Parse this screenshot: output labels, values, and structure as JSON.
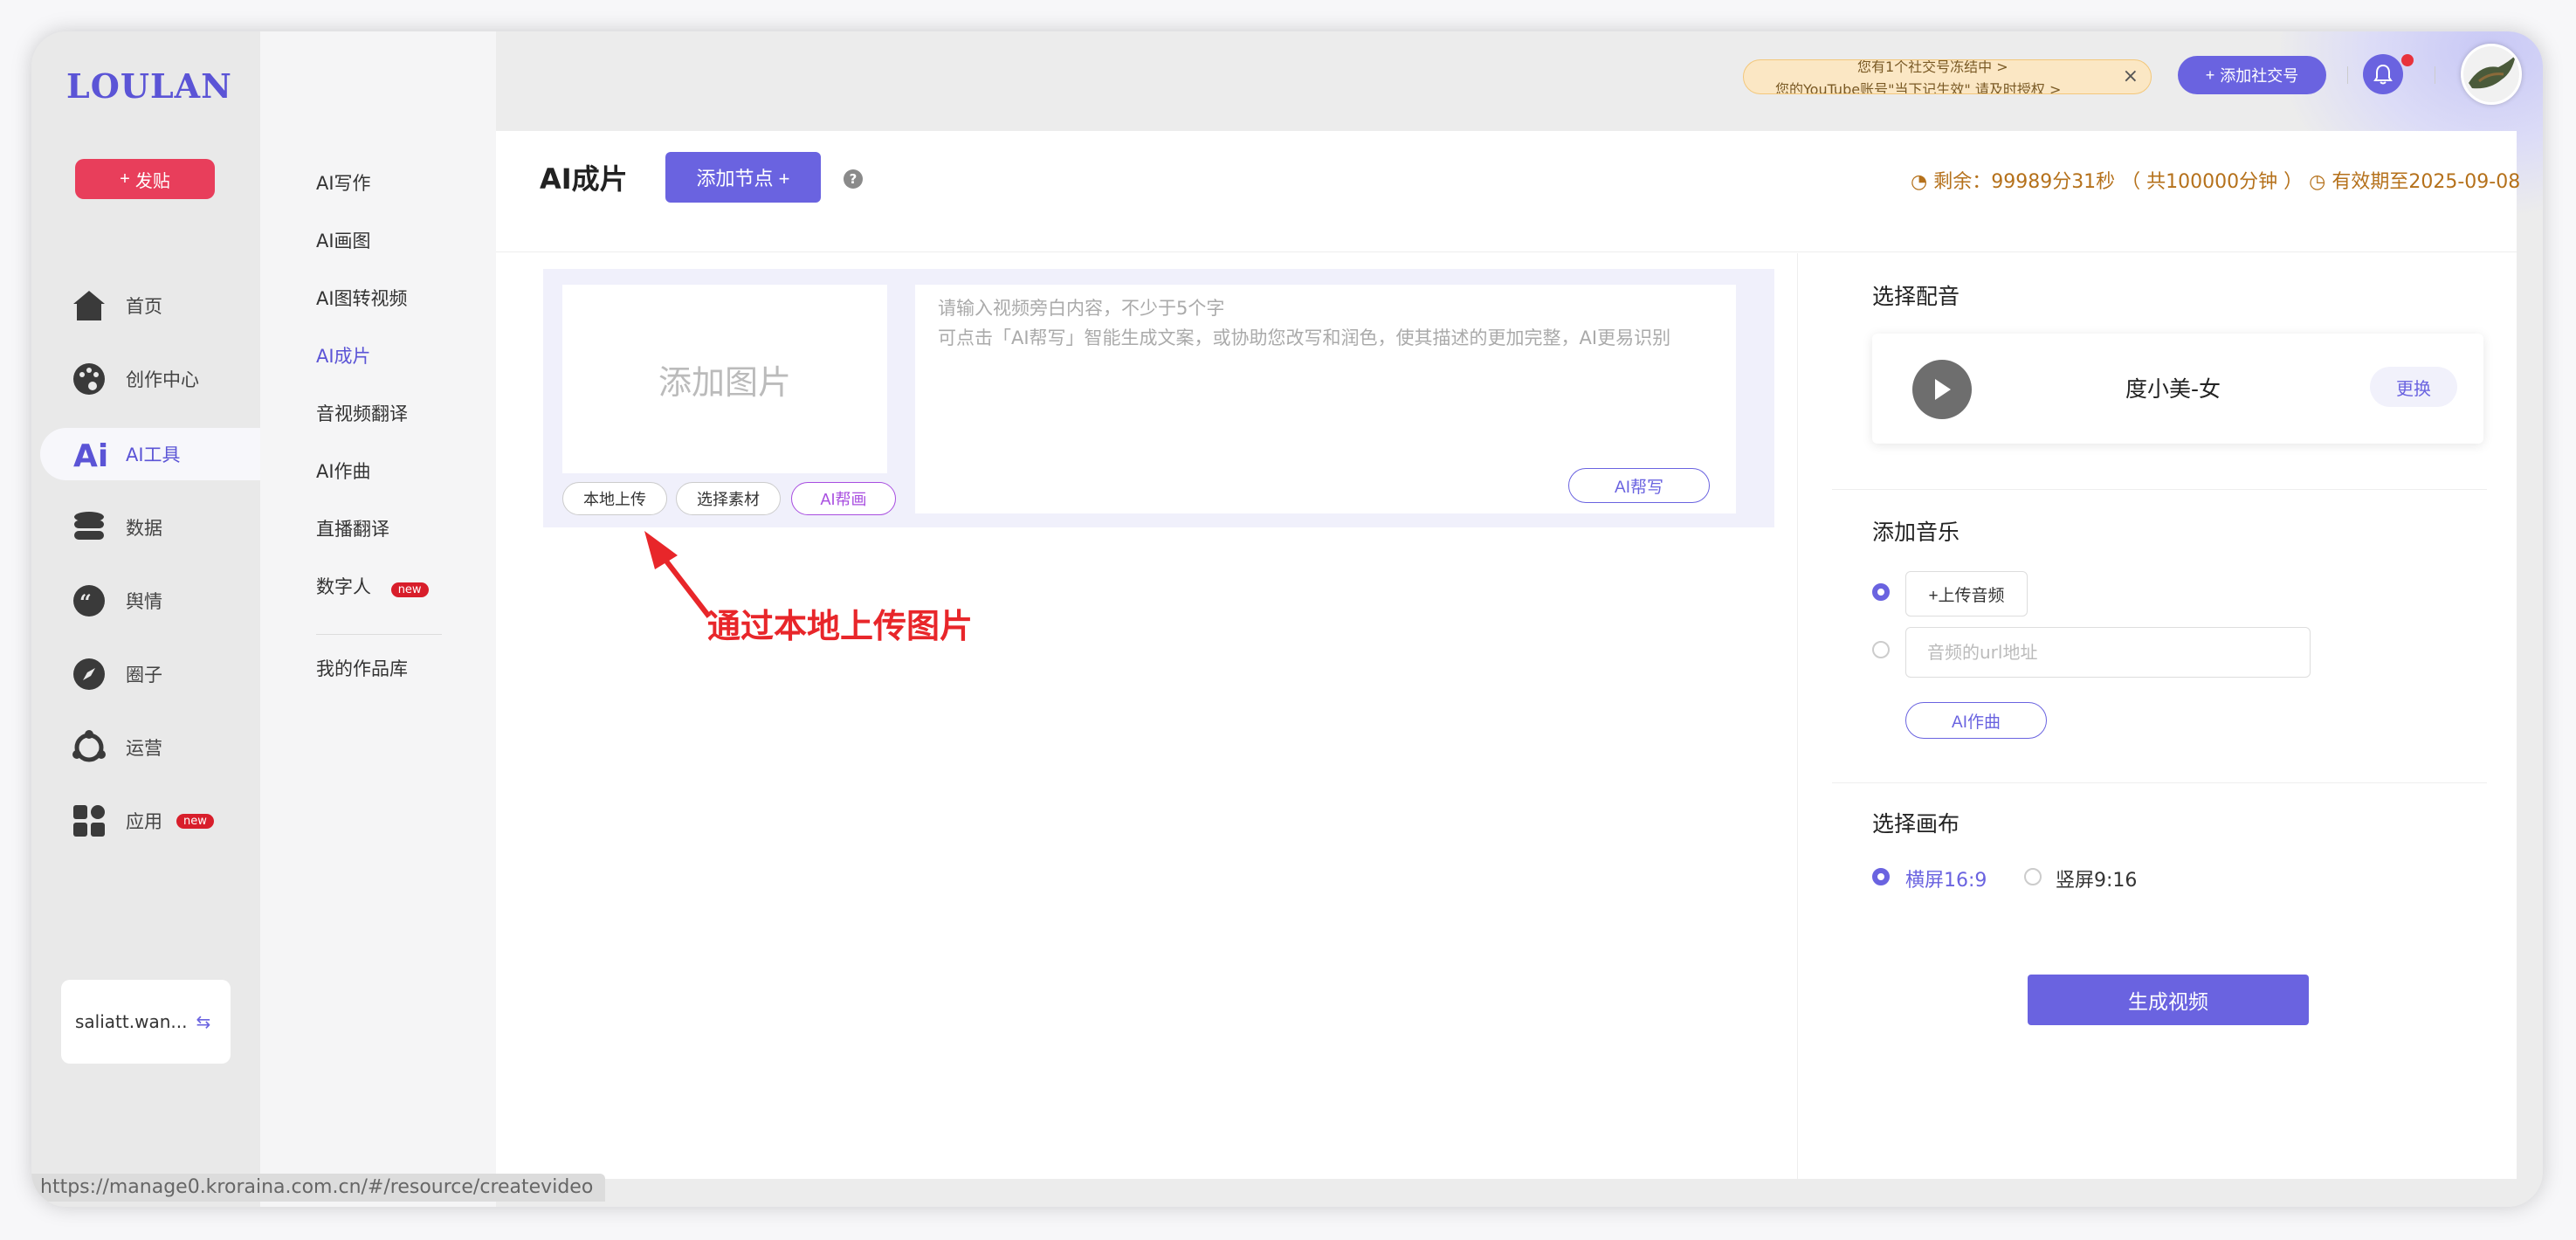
{
  "app": {
    "logo": "LOULAN",
    "publish_label": "发贴",
    "account_name": "saliatt.wan..."
  },
  "nav": [
    {
      "label": "首页",
      "icon": "home-icon"
    },
    {
      "label": "创作中心",
      "icon": "palette-icon"
    },
    {
      "label": "AI工具",
      "icon": "ai-icon",
      "active": true
    },
    {
      "label": "数据",
      "icon": "database-icon"
    },
    {
      "label": "舆情",
      "icon": "quote-icon"
    },
    {
      "label": "圈子",
      "icon": "compass-icon"
    },
    {
      "label": "运营",
      "icon": "operations-icon"
    },
    {
      "label": "应用",
      "icon": "apps-icon",
      "badge": "new"
    }
  ],
  "subnav": {
    "items": [
      "AI写作",
      "AI画图",
      "AI图转视频",
      "AI成片",
      "音视频翻译",
      "AI作曲",
      "直播翻译",
      "数字人"
    ],
    "new_badge": "new",
    "library": "我的作品库"
  },
  "topbar": {
    "notice_line1": "您有1个社交号冻结中 >",
    "notice_line2": "您的YouTube账号\"当下记生效\" 请及时授权 >",
    "add_social_label": "添加社交号"
  },
  "page": {
    "title": "AI成片",
    "add_node_label": "添加节点 +",
    "help": "?",
    "remaining": "剩余：99989分31秒 （ 共100000分钟 ）",
    "valid_until": "有效期至2025-09-08"
  },
  "node": {
    "add_image": "添加图片",
    "local_upload": "本地上传",
    "choose_material": "选择素材",
    "ai_draw": "AI帮画",
    "placeholder_line1": "请输入视频旁白内容，不少于5个字",
    "placeholder_line2": "可点击「AI帮写」智能生成文案，或协助您改写和润色，使其描述的更加完整，AI更易识别",
    "ai_write": "AI帮写"
  },
  "annotation": "通过本地上传图片",
  "right": {
    "voice_title": "选择配音",
    "voice_name": "度小美-女",
    "change_label": "更换",
    "music_title": "添加音乐",
    "upload_audio": "+上传音频",
    "url_placeholder": "音频的url地址",
    "ai_compose": "AI作曲",
    "canvas_title": "选择画布",
    "landscape": "横屏16:9",
    "portrait": "竖屏9:16",
    "generate": "生成视频"
  },
  "status_url": "https://manage0.kroraina.com.cn/#/resource/createvideo",
  "colors": {
    "accent": "#6a63e0",
    "publish": "#e83e5b",
    "remaining": "#b5711b",
    "annotation": "#e8262a"
  }
}
